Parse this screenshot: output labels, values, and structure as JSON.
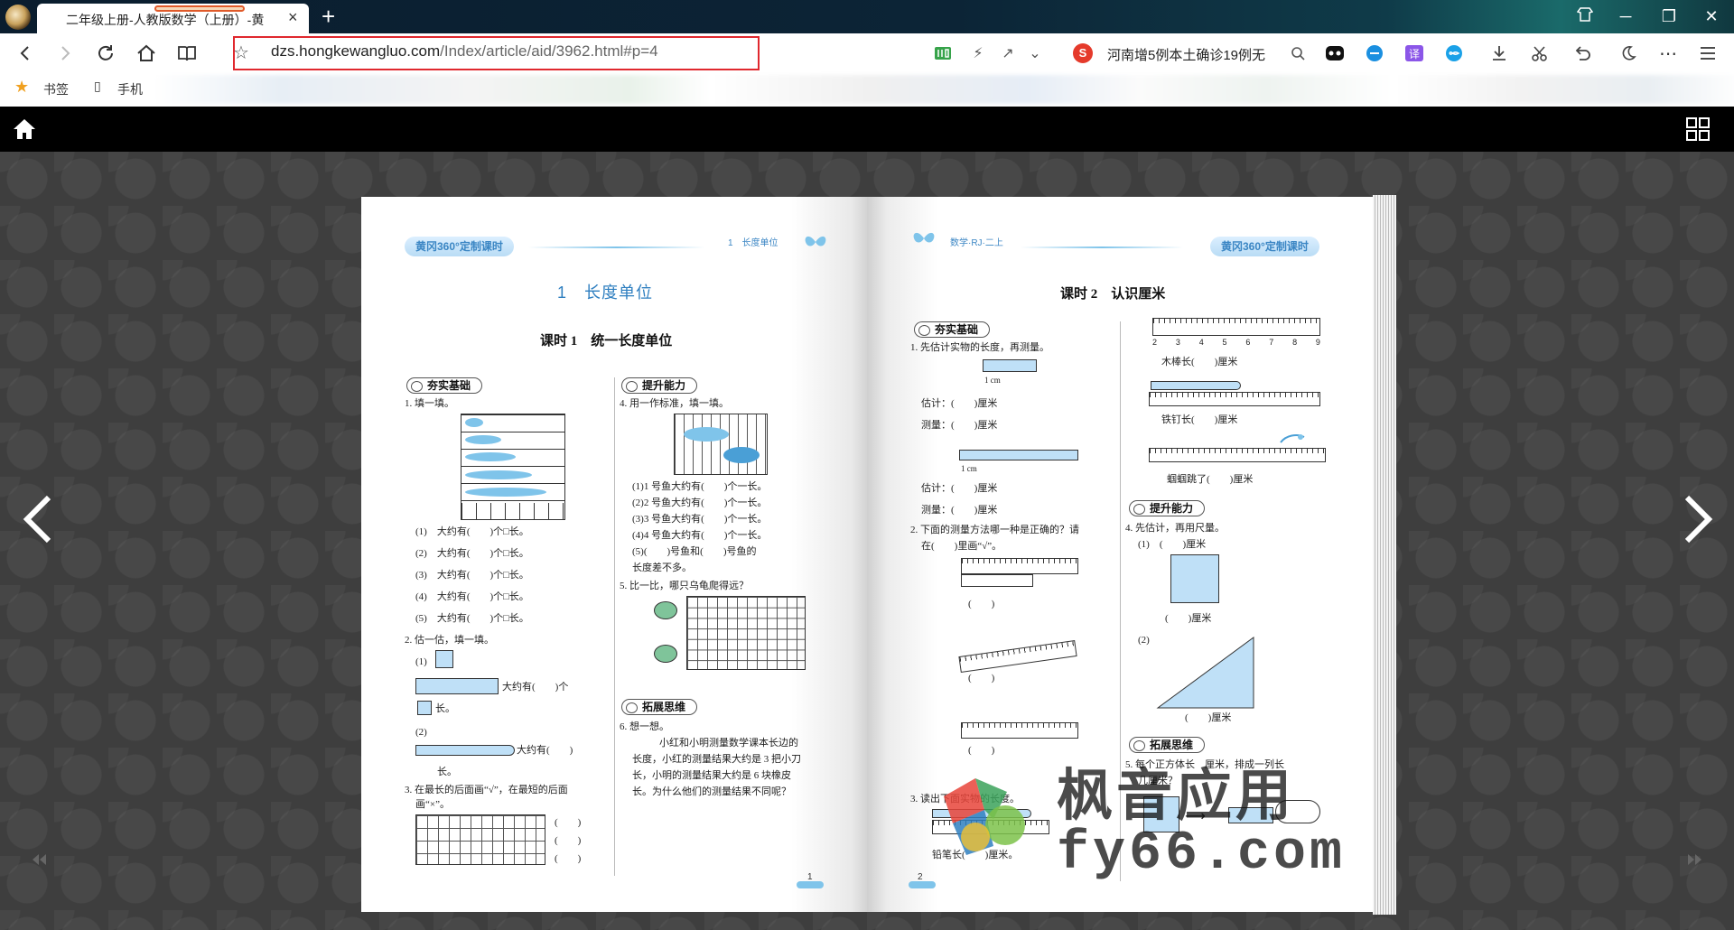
{
  "browser": {
    "tab": {
      "title": "二年级上册-人教版数学（上册）-黄",
      "close": "×"
    },
    "new_tab": "+",
    "window_controls": {
      "minimize": "─",
      "restore": "❐",
      "close": "✕"
    },
    "address": {
      "url_host": "dzs.hongkewangluo.com",
      "url_path": "/Index/article/aid/3962.html#p=4"
    },
    "search": {
      "text": "河南增5例本土确诊19例无"
    },
    "bookmarks": [
      {
        "label": "书签"
      },
      {
        "label": "手机"
      }
    ]
  },
  "reader": {
    "icons": [
      "home-icon",
      "grid-view-icon",
      "prev-page-icon",
      "next-page-icon",
      "first-page-icon",
      "last-page-icon"
    ],
    "left_page": {
      "header_pill": "黄冈360°定制课时",
      "header_small": "1　长度单位",
      "unit_title": "1　长度单位",
      "lesson_title": "课时 1　统一长度单位",
      "sections": [
        "夯实基础",
        "提升能力",
        "拓展思维"
      ],
      "q1": "1. 填一填。",
      "q1_items": [
        "(1)　大约有(　　)个□长。",
        "(2)　大约有(　　)个□长。",
        "(3)　大约有(　　)个□长。",
        "(4)　大约有(　　)个□长。",
        "(5)　大约有(　　)个□长。"
      ],
      "q2": "2. 估一估，填一填。",
      "q2_items": [
        "(1)",
        "大约有(　　)个",
        "长。",
        "(2)",
        "大约有(　　)",
        "长。"
      ],
      "q3": "3. 在最长的后面画“√”，在最短的后面",
      "q3b": "画“×”。",
      "q3_blanks": [
        "(　　)",
        "(　　)",
        "(　　)"
      ],
      "q4": "4. 用一作标准，填一填。",
      "q4_items": [
        "(1)1 号鱼大约有(　　)个一长。",
        "(2)2 号鱼大约有(　　)个一长。",
        "(3)3 号鱼大约有(　　)个一长。",
        "(4)4 号鱼大约有(　　)个一长。",
        "(5)(　　)号鱼和(　　)号鱼的",
        "长度差不多。"
      ],
      "q5": "5. 比一比，哪只乌龟爬得远？",
      "q6": "6. 想一想。",
      "q6_text": [
        "小红和小明测量数学课本长边的",
        "长度，小红的测量结果大约是 3 把小刀",
        "长，小明的测量结果大约是 6 块橡皮",
        "长。为什么他们的测量结果不同呢？"
      ],
      "page_number": "1"
    },
    "right_page": {
      "header_small": "数学·RJ·二上",
      "header_pill": "黄冈360°定制课时",
      "lesson_title": "课时 2　认识厘米",
      "sections": [
        "夯实基础",
        "提升能力",
        "拓展思维"
      ],
      "q1": "1. 先估计实物的长度，再测量。",
      "q1_items": [
        "估计：(　　)厘米",
        "测量：(　　)厘米",
        "估计：(　　)厘米",
        "测量：(　　)厘米"
      ],
      "cm_label": "1 cm",
      "q2": "2. 下面的测量方法哪一种是正确的？请",
      "q2b": "在(　　)里画“√”。",
      "q2_blanks": [
        "(　　)",
        "(　　)",
        "(　　)"
      ],
      "q3": "3. 读出下面实物的长度。",
      "q3_item": "铅笔长(　　)厘米。",
      "ruler_nums": [
        "2",
        "3",
        "4",
        "5",
        "6",
        "7",
        "8",
        "9"
      ],
      "ruler_items": [
        "木棒长(　　)厘米",
        "铁钉长(　　)厘米",
        "蝈蝈跳了(　　)厘米"
      ],
      "q4": "4. 先估计，再用尺量。",
      "q4_items": [
        "(1)　(　　)厘米",
        "(　　)厘米",
        "(2)",
        "(　　)厘米"
      ],
      "q5": "5. 每个正方体长　厘米，排成一列长",
      "q5b": "几厘米？",
      "page_number": "2"
    }
  },
  "watermark": {
    "cn": "枫音应用",
    "en": "fy66.com"
  }
}
